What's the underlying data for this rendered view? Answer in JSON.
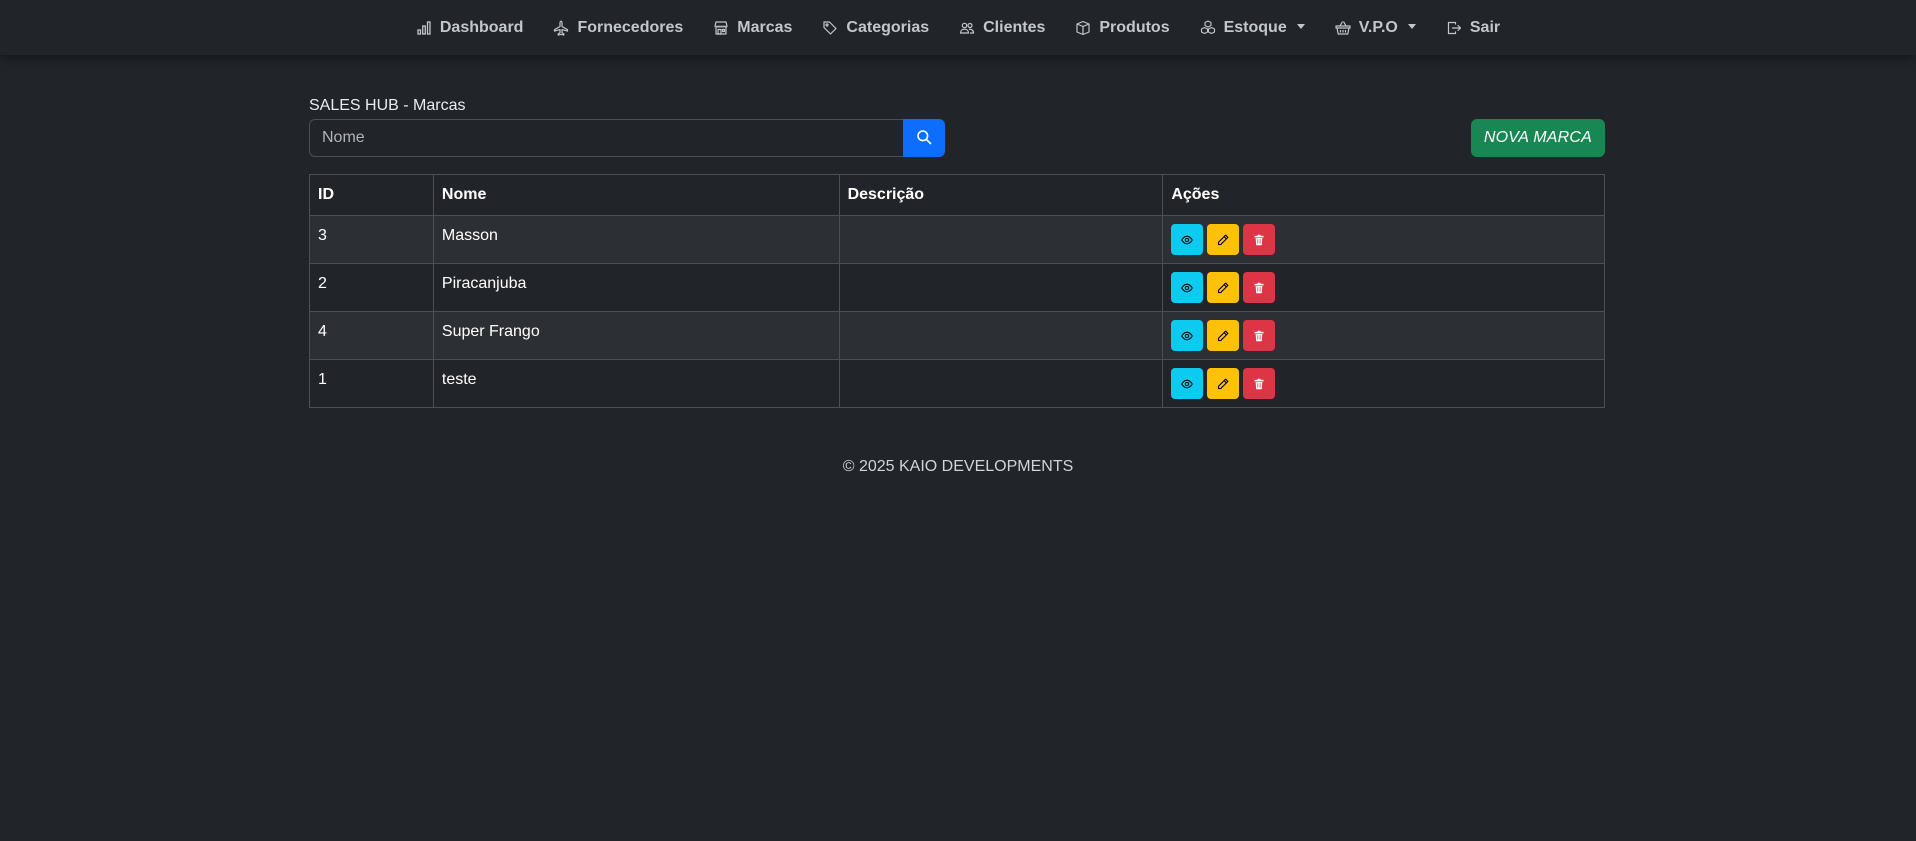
{
  "nav": {
    "items": [
      {
        "label": "Dashboard",
        "icon": "bar-chart-icon",
        "dropdown": false
      },
      {
        "label": "Fornecedores",
        "icon": "airplane-icon",
        "dropdown": false
      },
      {
        "label": "Marcas",
        "icon": "shop-icon",
        "dropdown": false
      },
      {
        "label": "Categorias",
        "icon": "tags-icon",
        "dropdown": false
      },
      {
        "label": "Clientes",
        "icon": "people-icon",
        "dropdown": false
      },
      {
        "label": "Produtos",
        "icon": "box-icon",
        "dropdown": false
      },
      {
        "label": "Estoque",
        "icon": "boxes-icon",
        "dropdown": true
      },
      {
        "label": "V.P.O",
        "icon": "basket-icon",
        "dropdown": true
      },
      {
        "label": "Sair",
        "icon": "box-arrow-right-icon",
        "dropdown": false
      }
    ]
  },
  "page": {
    "title": "SALES HUB - Marcas"
  },
  "search": {
    "placeholder": "Nome",
    "value": ""
  },
  "toolbar": {
    "new_label": "NOVA MARCA"
  },
  "table": {
    "headers": [
      "ID",
      "Nome",
      "Descrição",
      "Ações"
    ],
    "rows": [
      {
        "id": "3",
        "nome": "Masson",
        "descricao": ""
      },
      {
        "id": "2",
        "nome": "Piracanjuba",
        "descricao": ""
      },
      {
        "id": "4",
        "nome": "Super Frango",
        "descricao": ""
      },
      {
        "id": "1",
        "nome": "teste",
        "descricao": ""
      }
    ]
  },
  "footer": {
    "text": "© 2025 KAIO DEVELOPMENTS"
  },
  "colors": {
    "background": "#212529",
    "primary": "#0d6efd",
    "success": "#198754",
    "info": "#0dcaf0",
    "warning": "#ffc107",
    "danger": "#dc3545"
  }
}
